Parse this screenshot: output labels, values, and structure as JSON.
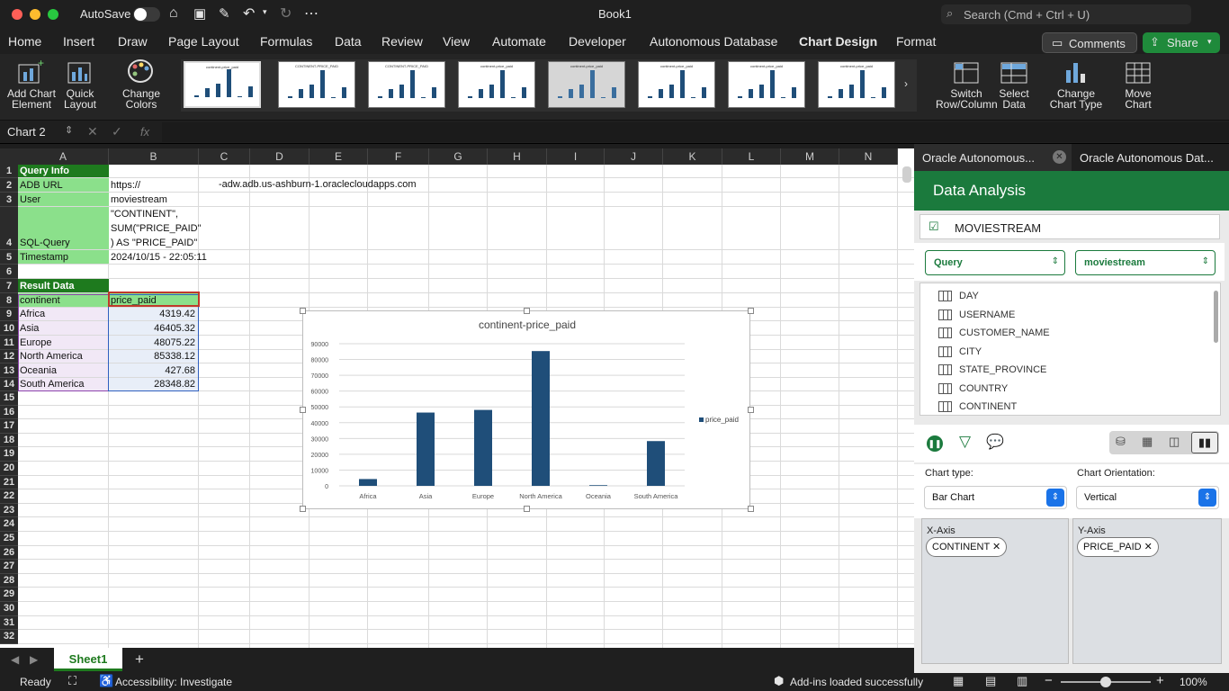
{
  "titlebar": {
    "autosave": "AutoSave",
    "title": "Book1",
    "search_placeholder": "Search (Cmd + Ctrl + U)"
  },
  "ribbon_tabs": [
    "Home",
    "Insert",
    "Draw",
    "Page Layout",
    "Formulas",
    "Data",
    "Review",
    "View",
    "Automate",
    "Developer",
    "Autonomous Database",
    "Chart Design",
    "Format"
  ],
  "active_tab": "Chart Design",
  "comments_label": "Comments",
  "share_label": "Share",
  "ribbon": {
    "add_chart": [
      "Add Chart",
      "Element"
    ],
    "quick_layout": [
      "Quick",
      "Layout"
    ],
    "change_colors": [
      "Change",
      "Colors"
    ],
    "switch": [
      "Switch",
      "Row/Column"
    ],
    "select_data": [
      "Select",
      "Data"
    ],
    "change_type": [
      "Change",
      "Chart Type"
    ],
    "move_chart": [
      "Move",
      "Chart"
    ],
    "thumb_titles": [
      "continent-price_paid",
      "CONTINENT-PRICE_PAID",
      "CONTINENT-PRICE_PAID",
      "continent-price_paid",
      "continent-price_paid",
      "continent-price_paid",
      "continent-price_paid",
      "continent-price_paid"
    ]
  },
  "formula": {
    "namebox": "Chart 2",
    "fx": "fx"
  },
  "columns": [
    "A",
    "B",
    "C",
    "D",
    "E",
    "F",
    "G",
    "H",
    "I",
    "J",
    "K",
    "L",
    "M",
    "N"
  ],
  "rows": [
    "1",
    "2",
    "3",
    "4",
    "5",
    "6",
    "7",
    "8",
    "9",
    "10",
    "11",
    "12",
    "13",
    "14",
    "15",
    "16",
    "17",
    "18",
    "19",
    "20",
    "21",
    "22",
    "23",
    "24",
    "25",
    "26",
    "27",
    "28",
    "29",
    "30",
    "31",
    "32"
  ],
  "sheet": {
    "query_info": "Query Info",
    "adb_url_label": "ADB URL",
    "adb_url_prefix": "https://",
    "adb_url_suffix": "-adw.adb.us-ashburn-1.oraclecloudapps.com",
    "user_label": "User",
    "user_value": "moviestream",
    "sql_label": "SQL-Query",
    "sql_lines": [
      "\"CONTINENT\",",
      "SUM(\"PRICE_PAID\"",
      ") AS \"PRICE_PAID\""
    ],
    "timestamp_label": "Timestamp",
    "timestamp_value": "2024/10/15 - 22:05:11",
    "result_data": "Result Data",
    "hdr_continent": "continent",
    "hdr_price": "price_paid",
    "result_rows": [
      {
        "continent": "Africa",
        "price": "4319.42"
      },
      {
        "continent": "Asia",
        "price": "46405.32"
      },
      {
        "continent": "Europe",
        "price": "48075.22"
      },
      {
        "continent": "North America",
        "price": "85338.12"
      },
      {
        "continent": "Oceania",
        "price": "427.68"
      },
      {
        "continent": "South America",
        "price": "28348.82"
      }
    ]
  },
  "chart_data": {
    "type": "bar",
    "title": "continent-price_paid",
    "categories": [
      "Africa",
      "Asia",
      "Europe",
      "North America",
      "Oceania",
      "South America"
    ],
    "series": [
      {
        "name": "price_paid",
        "values": [
          4319.42,
          46405.32,
          48075.22,
          85338.12,
          427.68,
          28348.82
        ]
      }
    ],
    "ylim": [
      0,
      90000
    ],
    "yticks": [
      "0",
      "10000",
      "20000",
      "30000",
      "40000",
      "50000",
      "60000",
      "70000",
      "80000",
      "90000"
    ],
    "grid": true,
    "legend": "right",
    "bar_color": "#1f4e79"
  },
  "pane": {
    "tab1": "Oracle Autonomous...",
    "tab2": "Oracle Autonomous Dat...",
    "header": "Data Analysis",
    "schema": "MOVIESTREAM",
    "mode": "Query",
    "connection": "moviestream",
    "columns": [
      "DAY",
      "USERNAME",
      "CUSTOMER_NAME",
      "CITY",
      "STATE_PROVINCE",
      "COUNTRY",
      "CONTINENT"
    ],
    "chart_type_label": "Chart type:",
    "chart_type": "Bar Chart",
    "orientation_label": "Chart Orientation:",
    "orientation": "Vertical",
    "x_axis_label": "X-Axis",
    "x_axis_value": "CONTINENT",
    "y_axis_label": "Y-Axis",
    "y_axis_value": "PRICE_PAID"
  },
  "sheet_tab": "Sheet1",
  "status": {
    "ready": "Ready",
    "accessibility": "Accessibility: Investigate",
    "addins": "Add-ins loaded successfully",
    "zoom": "100%"
  },
  "colors": {
    "green_header": "#1e7a1e",
    "green_light": "#8be08b",
    "pane_green": "#1b7a3d",
    "accent": "#1f4e79"
  }
}
